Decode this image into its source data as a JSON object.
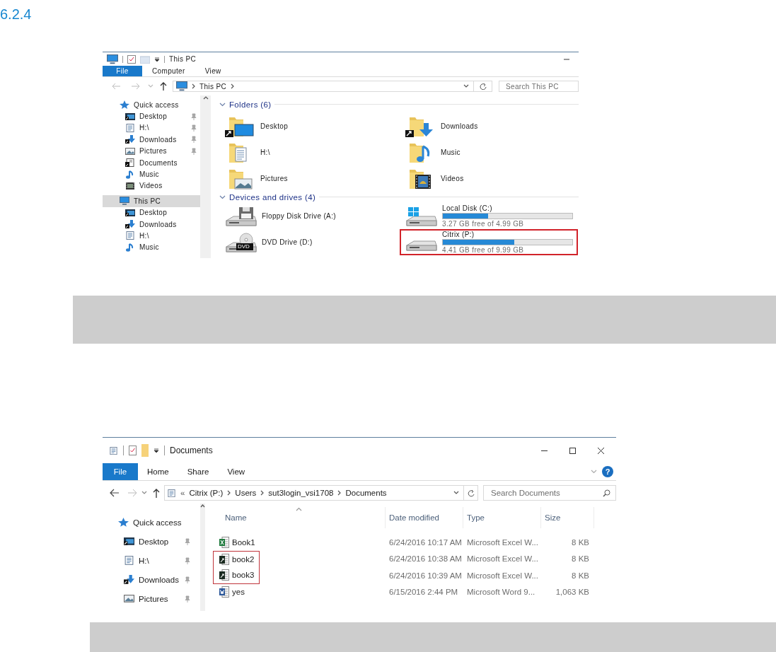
{
  "heading": "6.2.4",
  "window_1": {
    "title": "This PC",
    "ribbon_tabs": [
      {
        "label": "File",
        "selected": true
      },
      {
        "label": "Computer",
        "selected": false
      },
      {
        "label": "View",
        "selected": false
      }
    ],
    "address": [
      "This PC"
    ],
    "search": {
      "placeholder": "Search This PC"
    },
    "nav": [
      {
        "label": "Quick access",
        "kind": "star",
        "selected": false,
        "children": [
          {
            "label": "Desktop",
            "kind": "desktop",
            "pinned": true,
            "selected": false
          },
          {
            "label": "H:\\",
            "kind": "document",
            "pinned": true,
            "selected": false
          },
          {
            "label": "Downloads",
            "kind": "downloads",
            "pinned": true,
            "selected": false
          },
          {
            "label": "Pictures",
            "kind": "pictures",
            "pinned": true,
            "selected": false
          },
          {
            "label": "Documents",
            "kind": "documents",
            "pinned": false,
            "selected": false
          },
          {
            "label": "Music",
            "kind": "music",
            "pinned": false,
            "selected": false
          },
          {
            "label": "Videos",
            "kind": "videos",
            "pinned": false,
            "selected": false
          }
        ]
      },
      {
        "label": "This PC",
        "kind": "pc",
        "selected": true,
        "children": [
          {
            "label": "Desktop",
            "kind": "desktop",
            "pinned": false,
            "selected": false
          },
          {
            "label": "Downloads",
            "kind": "downloads",
            "pinned": false,
            "selected": false
          },
          {
            "label": "H:\\",
            "kind": "document",
            "pinned": false,
            "selected": false
          },
          {
            "label": "Music",
            "kind": "music",
            "pinned": false,
            "selected": false
          }
        ]
      }
    ],
    "sections": [
      {
        "title": "Folders (6)",
        "kind": "folders",
        "items": [
          {
            "label": "Desktop",
            "kind": "desktop",
            "linked": true
          },
          {
            "label": "Downloads",
            "kind": "downloads",
            "linked": true
          },
          {
            "label": "H:\\",
            "kind": "document",
            "linked": false
          },
          {
            "label": "Music",
            "kind": "music",
            "linked": false
          },
          {
            "label": "Pictures",
            "kind": "pictures",
            "linked": false
          },
          {
            "label": "Videos",
            "kind": "videos",
            "linked": false
          }
        ]
      },
      {
        "title": "Devices and drives (4)",
        "kind": "drives",
        "items": [
          {
            "label": "Floppy Disk Drive (A:)",
            "kind": "floppy",
            "highlighted": false
          },
          {
            "label": "Local Disk (C:)",
            "kind": "system",
            "level": 0.35,
            "free": "3.27 GB free of 4.99 GB",
            "highlighted": false
          },
          {
            "label": "DVD Drive (D:)",
            "kind": "dvd",
            "badge": "DVD",
            "highlighted": false
          },
          {
            "label": "Citrix (P:)",
            "kind": "disk",
            "level": 0.55,
            "free": "4.41 GB free of 9.99 GB",
            "highlighted": true
          }
        ]
      }
    ]
  },
  "window_2": {
    "title": "Documents",
    "ribbon_tabs": [
      {
        "label": "File",
        "selected": true
      },
      {
        "label": "Home",
        "selected": false
      },
      {
        "label": "Share",
        "selected": false
      },
      {
        "label": "View",
        "selected": false
      }
    ],
    "help": "?",
    "address_overflow": "«",
    "address": [
      "Citrix (P:)",
      "Users",
      "sut3login_vsi1708",
      "Documents"
    ],
    "search": {
      "placeholder": "Search Documents"
    },
    "nav": [
      {
        "label": "Quick access",
        "kind": "star",
        "selected": false,
        "children": [
          {
            "label": "Desktop",
            "kind": "desktop",
            "pinned": true,
            "selected": false
          },
          {
            "label": "H:\\",
            "kind": "document",
            "pinned": true,
            "selected": false
          },
          {
            "label": "Downloads",
            "kind": "downloads",
            "pinned": true,
            "selected": false
          },
          {
            "label": "Pictures",
            "kind": "pictures",
            "pinned": true,
            "selected": false
          }
        ]
      }
    ],
    "columns": [
      {
        "label": "Name",
        "sorted": true
      },
      {
        "label": "Date modified",
        "sorted": false
      },
      {
        "label": "Type",
        "sorted": false
      },
      {
        "label": "Size",
        "sorted": false
      }
    ],
    "rows": [
      {
        "name": "Book1",
        "kind": "excel",
        "date": "6/24/2016 10:17 AM",
        "type": "Microsoft Excel W...",
        "size": "8 KB",
        "highlighted": false
      },
      {
        "name": "book2",
        "kind": "linked",
        "date": "6/24/2016 10:38 AM",
        "type": "Microsoft Excel W...",
        "size": "8 KB",
        "highlighted": true
      },
      {
        "name": "book3",
        "kind": "linked",
        "date": "6/24/2016 10:39 AM",
        "type": "Microsoft Excel W...",
        "size": "8 KB",
        "highlighted": true
      },
      {
        "name": "yes",
        "kind": "word",
        "date": "6/15/2016 2:44 PM",
        "type": "Microsoft Word 9...",
        "size": "1,063 KB",
        "highlighted": false
      }
    ]
  }
}
